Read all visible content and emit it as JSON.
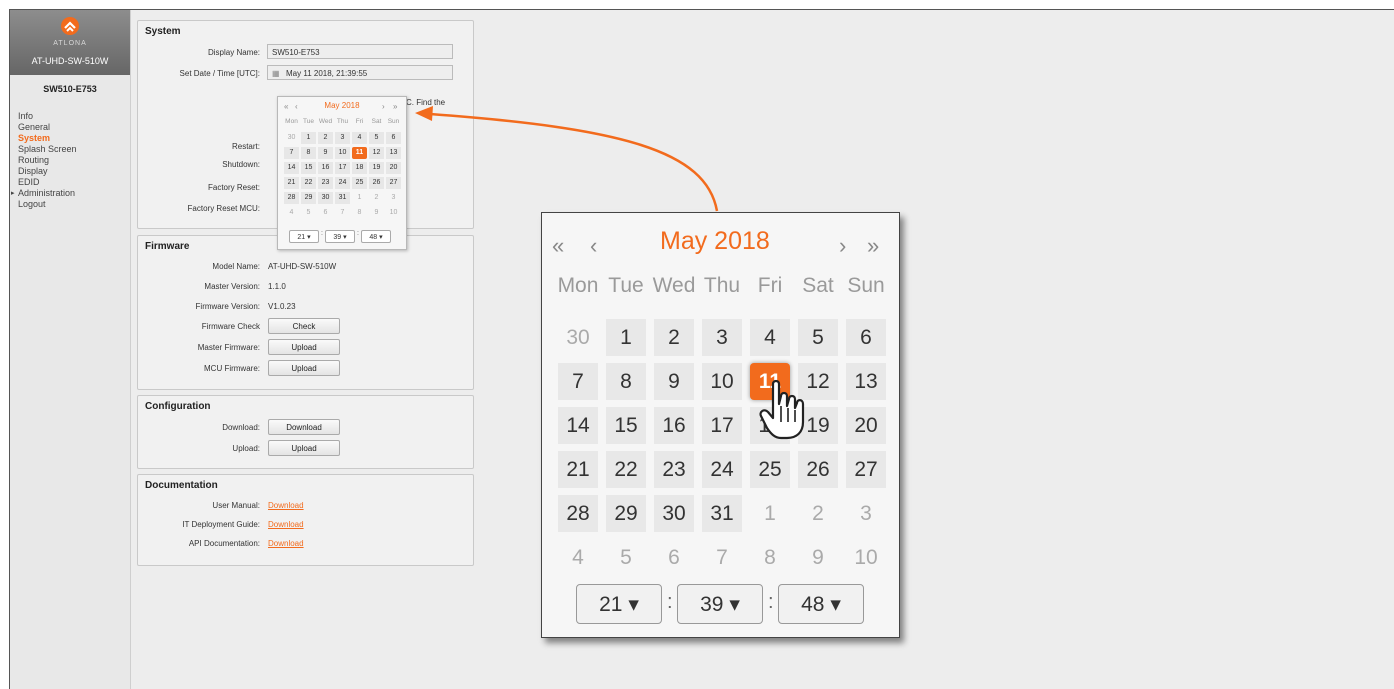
{
  "sidebar": {
    "brand": "ATLONA",
    "model": "AT-UHD-SW-510W",
    "device_name": "SW510-E753",
    "items": [
      {
        "label": "Info"
      },
      {
        "label": "General"
      },
      {
        "label": "System",
        "active": true
      },
      {
        "label": "Splash Screen"
      },
      {
        "label": "Routing"
      },
      {
        "label": "Display"
      },
      {
        "label": "EDID"
      },
      {
        "label": "Administration",
        "expandable": true
      },
      {
        "label": "Logout"
      }
    ]
  },
  "system": {
    "title": "System",
    "display_name_label": "Display Name:",
    "display_name_value": "SW510-E753",
    "datetime_label": "Set Date / Time [UTC]:",
    "datetime_value": "May 11 2018, 21:39:55",
    "partial_text": "C. Find the",
    "restart_label": "Restart:",
    "shutdown_label": "Shutdown:",
    "factory_reset_label": "Factory Reset:",
    "factory_reset_mcu_label": "Factory Reset MCU:"
  },
  "firmware": {
    "title": "Firmware",
    "model_label": "Model Name:",
    "model_value": "AT-UHD-SW-510W",
    "master_version_label": "Master Version:",
    "master_version_value": "1.1.0",
    "firmware_version_label": "Firmware Version:",
    "firmware_version_value": "V1.0.23",
    "firmware_check_label": "Firmware Check",
    "check_button": "Check",
    "master_firmware_label": "Master Firmware:",
    "upload_button": "Upload",
    "mcu_firmware_label": "MCU Firmware:"
  },
  "configuration": {
    "title": "Configuration",
    "download_label": "Download:",
    "download_button": "Download",
    "upload_label": "Upload:",
    "upload_button": "Upload"
  },
  "documentation": {
    "title": "Documentation",
    "user_manual_label": "User Manual:",
    "it_guide_label": "IT Deployment Guide:",
    "api_doc_label": "API Documentation:",
    "link_text": "Download"
  },
  "calendar": {
    "month_title": "May 2018",
    "prev_year": "«",
    "prev_month": "‹",
    "next_month": "›",
    "next_year": "»",
    "weekdays": [
      "Mon",
      "Tue",
      "Wed",
      "Thu",
      "Fri",
      "Sat",
      "Sun"
    ],
    "weeks": [
      [
        "30",
        "1",
        "2",
        "3",
        "4",
        "5",
        "6"
      ],
      [
        "7",
        "8",
        "9",
        "10",
        "11",
        "12",
        "13"
      ],
      [
        "14",
        "15",
        "16",
        "17",
        "18",
        "19",
        "20"
      ],
      [
        "21",
        "22",
        "23",
        "24",
        "25",
        "26",
        "27"
      ],
      [
        "28",
        "29",
        "30",
        "31",
        "1",
        "2",
        "3"
      ],
      [
        "4",
        "5",
        "6",
        "7",
        "8",
        "9",
        "10"
      ]
    ],
    "selected_day": "11",
    "hour": "21",
    "minute": "39",
    "second": "48",
    "accent_color": "#f26b1d"
  }
}
